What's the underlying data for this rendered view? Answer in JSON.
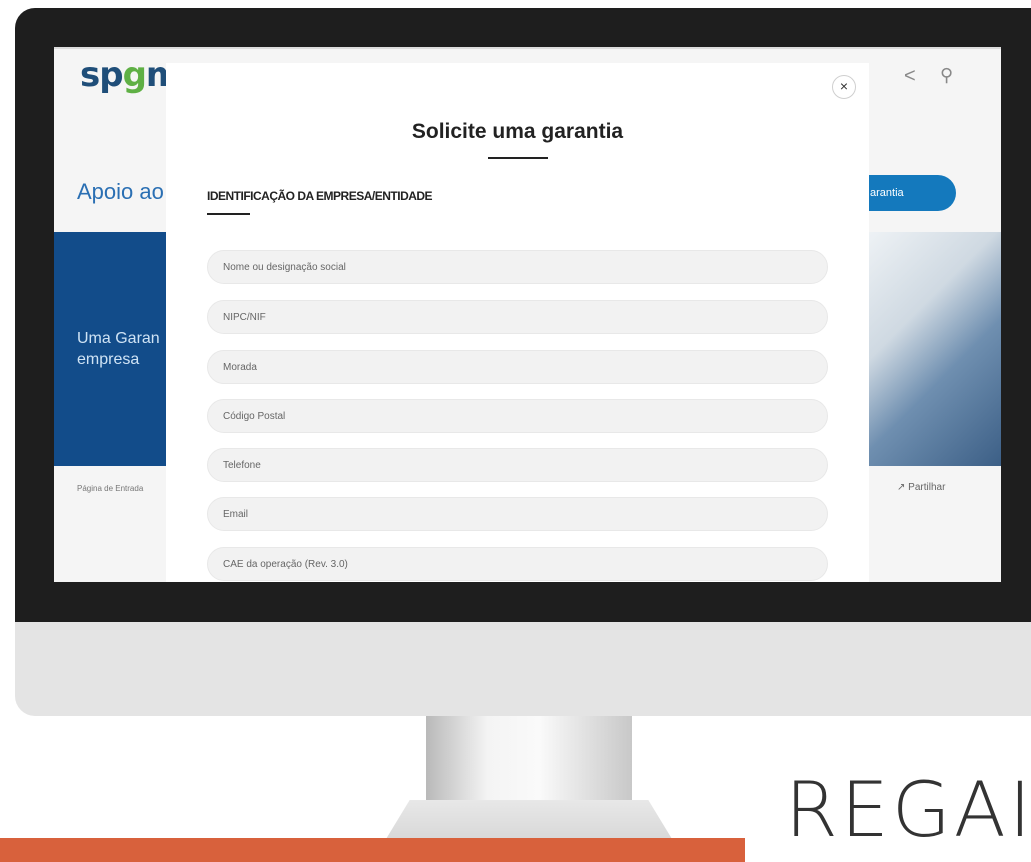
{
  "website": {
    "logo": [
      "sp",
      "g",
      "m"
    ],
    "hero_title": "Apoio ao",
    "hero_button": "arantia",
    "banner_text": "Uma Garan empresa",
    "breadcrumb": "Página de Entrada",
    "share_label": "Partilhar"
  },
  "modal": {
    "title": "Solicite uma garantia",
    "section_title": "IDENTIFICAÇÃO DA EMPRESA/ENTIDADE",
    "close_symbol": "×",
    "fields": [
      {
        "placeholder": "Nome ou designação social"
      },
      {
        "placeholder": "NIPC/NIF"
      },
      {
        "placeholder": "Morada"
      },
      {
        "placeholder": "Código Postal"
      },
      {
        "placeholder": "Telefone"
      },
      {
        "placeholder": "Email"
      },
      {
        "placeholder": "CAE da operação (Rev. 3.0)"
      }
    ]
  },
  "brand_text": "REGAI",
  "icons": {
    "share": "share-icon",
    "search": "search-icon",
    "close": "close-icon",
    "share_link": "share-arrow-icon"
  },
  "colors": {
    "banner": "#124c8a",
    "hero_title": "#2a6fb3",
    "button": "#1479bd",
    "floor_bar": "#d8613c"
  }
}
